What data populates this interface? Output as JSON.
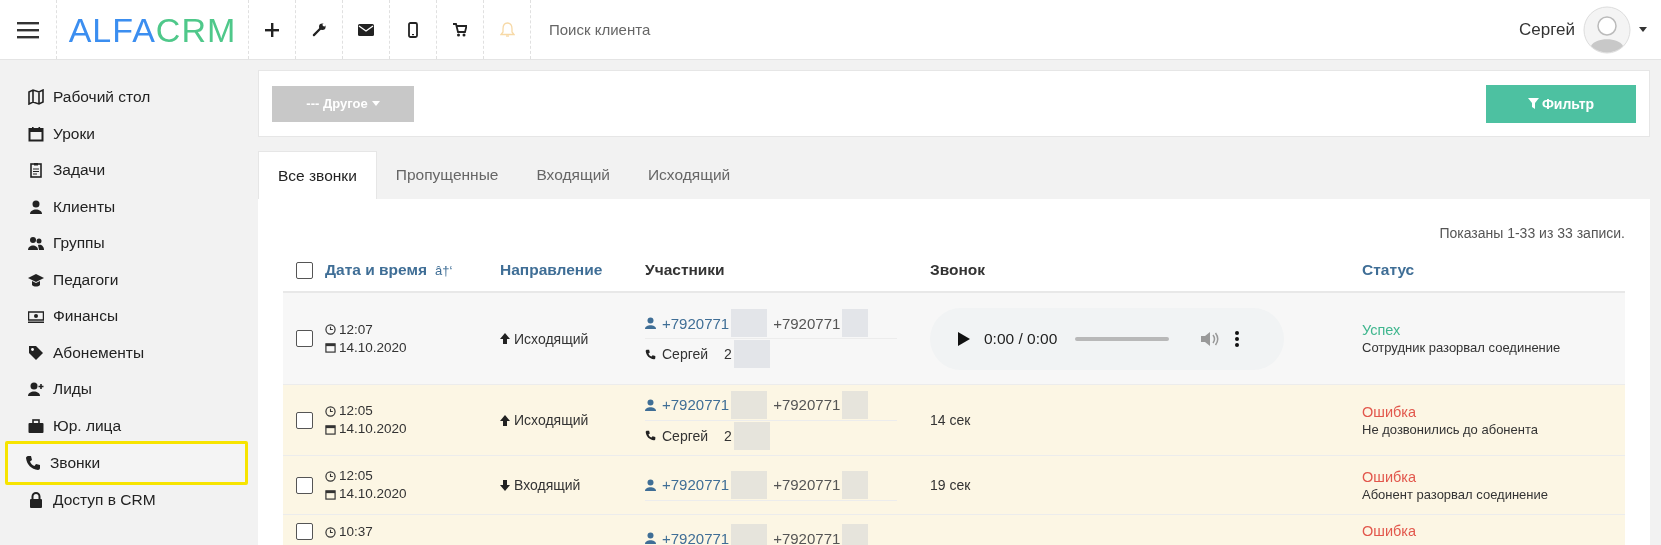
{
  "header": {
    "logo": {
      "first": "ALFA",
      "second": "CRM"
    },
    "search": {
      "placeholder": "Поиск клиента"
    },
    "user": {
      "name": "Сергей"
    }
  },
  "sidebar": {
    "items": [
      {
        "label": "Рабочий стол",
        "selected": false
      },
      {
        "label": "Уроки",
        "selected": false
      },
      {
        "label": "Задачи",
        "selected": false
      },
      {
        "label": "Клиенты",
        "selected": false
      },
      {
        "label": "Группы",
        "selected": false
      },
      {
        "label": "Педагоги",
        "selected": false
      },
      {
        "label": "Финансы",
        "selected": false
      },
      {
        "label": "Абонементы",
        "selected": false
      },
      {
        "label": "Лиды",
        "selected": false
      },
      {
        "label": "Юр. лица",
        "selected": false
      },
      {
        "label": "Звонки",
        "selected": true
      },
      {
        "label": "Доступ в CRM",
        "selected": false
      }
    ]
  },
  "filter_bar": {
    "dropdown": "--- Другое",
    "filter_button": "Фильтр"
  },
  "tabs": [
    {
      "label": "Все звонки",
      "selected": true
    },
    {
      "label": "Пропущенные",
      "selected": false
    },
    {
      "label": "Входящий",
      "selected": false
    },
    {
      "label": "Исходящий",
      "selected": false
    }
  ],
  "table": {
    "summary": "Показаны 1-33 из 33 записи.",
    "select_all_checked": false,
    "columns": [
      {
        "label": "Дата и время",
        "sortable": true,
        "sort_mark": "â†‘"
      },
      {
        "label": "Направление",
        "sortable": true
      },
      {
        "label": "Участники",
        "sortable": false
      },
      {
        "label": "Звонок",
        "sortable": false
      },
      {
        "label": "Статус",
        "sortable": true
      }
    ],
    "rows": [
      {
        "checked": false,
        "time": "12:07",
        "date": "14.10.2020",
        "direction": {
          "kind": "outgoing",
          "label": "Исходящий"
        },
        "phone_1": "+7920771",
        "phone_2": "+7920771",
        "employee": "Сергей",
        "employee_extra": "2",
        "call": {
          "kind": "player",
          "time": "0:00 / 0:00"
        },
        "status": {
          "kind": "success",
          "title": "Успех",
          "detail": "Сотрудник разорвал соединение"
        }
      },
      {
        "checked": false,
        "time": "12:05",
        "date": "14.10.2020",
        "direction": {
          "kind": "outgoing",
          "label": "Исходящий"
        },
        "phone_1": "+7920771",
        "phone_2": "+7920771",
        "employee": "Сергей",
        "employee_extra": "2",
        "call": {
          "kind": "duration",
          "text": "14 сек"
        },
        "status": {
          "kind": "error",
          "title": "Ошибка",
          "detail": "Не дозвонились до абонента"
        }
      },
      {
        "checked": false,
        "time": "12:05",
        "date": "14.10.2020",
        "direction": {
          "kind": "incoming",
          "label": "Входящий"
        },
        "phone_1": "+7920771",
        "phone_2": "+7920771",
        "call": {
          "kind": "duration",
          "text": "19 сек"
        },
        "status": {
          "kind": "error",
          "title": "Ошибка",
          "detail": "Абонент разорвал соединение"
        }
      },
      {
        "checked": false,
        "time": "10:37",
        "phone_1": "+7920771",
        "phone_2": "+7920771",
        "status": {
          "kind": "error",
          "title": "Ошибка"
        }
      }
    ]
  }
}
